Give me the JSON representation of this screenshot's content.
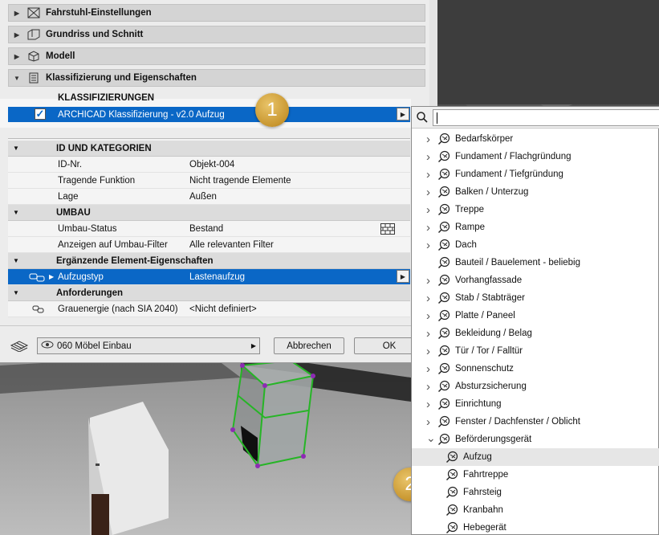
{
  "sections": [
    {
      "label": "Fahrstuhl-Einstellungen",
      "icon": "elevator-settings-icon"
    },
    {
      "label": "Grundriss und Schnitt",
      "icon": "floorplan-icon"
    },
    {
      "label": "Modell",
      "icon": "cube-icon"
    },
    {
      "label": "Klassifizierung und Eigenschaften",
      "icon": "document-icon"
    }
  ],
  "classification": {
    "header": "KLASSIFIZIERUNGEN",
    "row_label": "ARCHICAD Klassifizierung - v2.0 Aufzug",
    "checked": true
  },
  "groups": {
    "id": "ID UND KATEGORIEN",
    "umbau": "UMBAU",
    "ergaenzend": "Ergänzende Element-Eigenschaften",
    "anforderungen": "Anforderungen"
  },
  "properties": {
    "id_nr": {
      "key": "ID-Nr.",
      "value": "Objekt-004"
    },
    "tragende": {
      "key": "Tragende Funktion",
      "value": "Nicht tragende Elemente"
    },
    "lage": {
      "key": "Lage",
      "value": "Außen"
    },
    "umbau_status": {
      "key": "Umbau-Status",
      "value": "Bestand"
    },
    "umbau_filter": {
      "key": "Anzeigen auf Umbau-Filter",
      "value": "Alle relevanten Filter"
    },
    "aufzugstyp": {
      "key": "Aufzugstyp",
      "value": "Lastenaufzug"
    },
    "grauenergie": {
      "key": "Grauenergie (nach SIA 2040)",
      "value": "<Nicht definiert>"
    }
  },
  "footer": {
    "favorite": "060 Möbel Einbau",
    "cancel": "Abbrechen",
    "ok": "OK"
  },
  "callouts": [
    "1",
    "2"
  ],
  "popup": {
    "search_value": "",
    "items": [
      {
        "label": "Bedarfskörper",
        "expand": "collapsed"
      },
      {
        "label": "Fundament / Flachgründung",
        "expand": "collapsed"
      },
      {
        "label": "Fundament / Tiefgründung",
        "expand": "collapsed"
      },
      {
        "label": "Balken / Unterzug",
        "expand": "collapsed"
      },
      {
        "label": "Treppe",
        "expand": "collapsed"
      },
      {
        "label": "Rampe",
        "expand": "collapsed"
      },
      {
        "label": "Dach",
        "expand": "collapsed"
      },
      {
        "label": "Bauteil / Bauelement - beliebig",
        "expand": "none"
      },
      {
        "label": "Vorhangfassade",
        "expand": "collapsed"
      },
      {
        "label": "Stab / Stabträger",
        "expand": "collapsed"
      },
      {
        "label": "Platte / Paneel",
        "expand": "collapsed"
      },
      {
        "label": "Bekleidung / Belag",
        "expand": "collapsed"
      },
      {
        "label": "Tür / Tor / Falltür",
        "expand": "collapsed"
      },
      {
        "label": "Sonnenschutz",
        "expand": "collapsed"
      },
      {
        "label": "Absturzsicherung",
        "expand": "collapsed"
      },
      {
        "label": "Einrichtung",
        "expand": "collapsed"
      },
      {
        "label": "Fenster / Dachfenster / Oblicht",
        "expand": "collapsed"
      },
      {
        "label": "Beförderungsgerät",
        "expand": "expanded"
      },
      {
        "label": "Aufzug",
        "expand": "child",
        "selected": true
      },
      {
        "label": "Fahrtreppe",
        "expand": "child"
      },
      {
        "label": "Fahrsteig",
        "expand": "child"
      },
      {
        "label": "Kranbahn",
        "expand": "child"
      },
      {
        "label": "Hebegerät",
        "expand": "child"
      }
    ]
  },
  "colors": {
    "selection": "#0a67c6",
    "callout": "#c8962f"
  }
}
